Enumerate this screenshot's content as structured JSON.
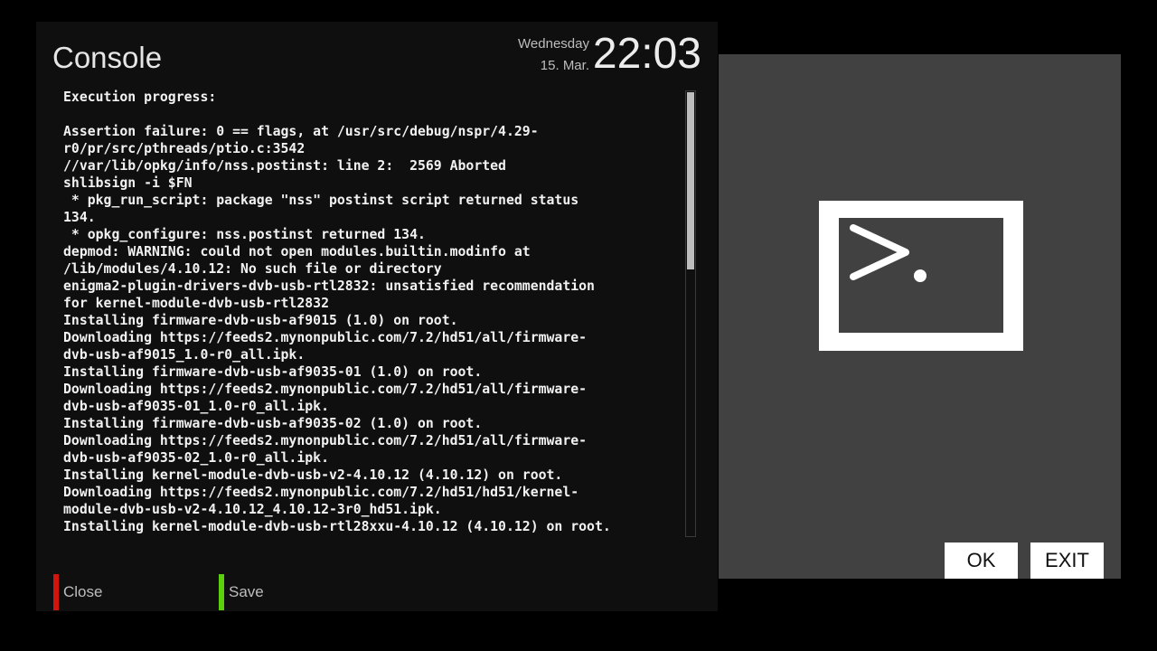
{
  "header": {
    "title": "Console",
    "weekday": "Wednesday",
    "date": "15. Mar.",
    "time": "22:03"
  },
  "console": {
    "lines": [
      "Execution progress:",
      "",
      "Assertion failure: 0 == flags, at /usr/src/debug/nspr/4.29-",
      "r0/pr/src/pthreads/ptio.c:3542",
      "//var/lib/opkg/info/nss.postinst: line 2:  2569 Aborted",
      "shlibsign -i $FN",
      " * pkg_run_script: package \"nss\" postinst script returned status",
      "134.",
      " * opkg_configure: nss.postinst returned 134.",
      "depmod: WARNING: could not open modules.builtin.modinfo at",
      "/lib/modules/4.10.12: No such file or directory",
      "enigma2-plugin-drivers-dvb-usb-rtl2832: unsatisfied recommendation",
      "for kernel-module-dvb-usb-rtl2832",
      "Installing firmware-dvb-usb-af9015 (1.0) on root.",
      "Downloading https://feeds2.mynonpublic.com/7.2/hd51/all/firmware-",
      "dvb-usb-af9015_1.0-r0_all.ipk.",
      "Installing firmware-dvb-usb-af9035-01 (1.0) on root.",
      "Downloading https://feeds2.mynonpublic.com/7.2/hd51/all/firmware-",
      "dvb-usb-af9035-01_1.0-r0_all.ipk.",
      "Installing firmware-dvb-usb-af9035-02 (1.0) on root.",
      "Downloading https://feeds2.mynonpublic.com/7.2/hd51/all/firmware-",
      "dvb-usb-af9035-02_1.0-r0_all.ipk.",
      "Installing kernel-module-dvb-usb-v2-4.10.12 (4.10.12) on root.",
      "Downloading https://feeds2.mynonpublic.com/7.2/hd51/hd51/kernel-",
      "module-dvb-usb-v2-4.10.12_4.10.12-3r0_hd51.ipk.",
      "Installing kernel-module-dvb-usb-rtl28xxu-4.10.12 (4.10.12) on root."
    ]
  },
  "footer": {
    "close_label": "Close",
    "save_label": "Save"
  },
  "actions": {
    "ok_label": "OK",
    "exit_label": "EXIT"
  },
  "icons": {
    "preview": "terminal-icon",
    "close_key": "red-key-indicator",
    "save_key": "green-key-indicator"
  },
  "colors": {
    "close_key": "#d0150c",
    "save_key": "#5cd00c",
    "background": "#000000",
    "panel": "#0f0f0f",
    "preview_panel": "#414141"
  }
}
